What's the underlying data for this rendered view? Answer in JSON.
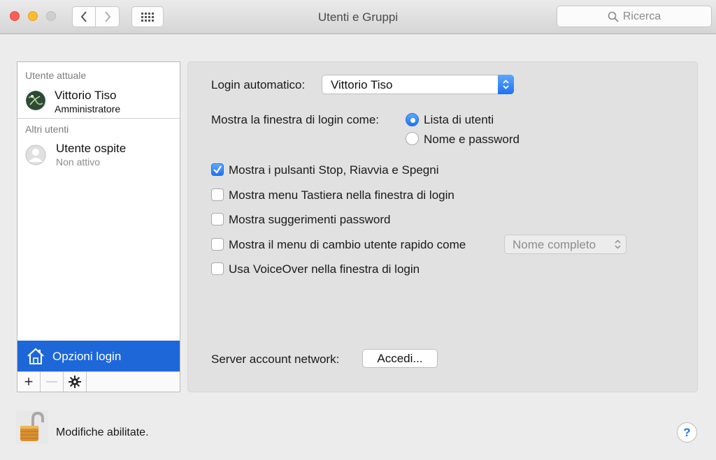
{
  "window": {
    "title": "Utenti e Gruppi"
  },
  "toolbar": {
    "search_placeholder": "Ricerca",
    "icons": {
      "back": "chevron-left-icon",
      "forward": "chevron-right-icon",
      "grid": "grid-icon",
      "search": "search-icon"
    }
  },
  "sidebar": {
    "current_user_header": "Utente attuale",
    "current_user": {
      "name": "Vittorio Tiso",
      "role": "Amministratore"
    },
    "other_users_header": "Altri utenti",
    "other_users": [
      {
        "name": "Utente ospite",
        "status": "Non attivo"
      }
    ],
    "login_options_label": "Opzioni login",
    "selected_color": "#1d67d9",
    "tools": {
      "add": "+",
      "remove": "—",
      "gear": "gear-icon"
    }
  },
  "main": {
    "auto_login_label": "Login automatico:",
    "auto_login_value": "Vittorio Tiso",
    "login_window_label": "Mostra la finestra di login come:",
    "radio_options": [
      {
        "label": "Lista di utenti",
        "selected": true
      },
      {
        "label": "Nome e password",
        "selected": false
      }
    ],
    "checkboxes": [
      {
        "label": "Mostra i pulsanti Stop, Riavvia e Spegni",
        "checked": true
      },
      {
        "label": "Mostra menu Tastiera nella finestra di login",
        "checked": false
      },
      {
        "label": "Mostra suggerimenti password",
        "checked": false
      },
      {
        "label": "Mostra il menu di cambio utente rapido come",
        "checked": false
      },
      {
        "label": "Usa VoiceOver nella finestra di login",
        "checked": false
      }
    ],
    "fast_switch_value": "Nome completo",
    "network_server_label": "Server account network:",
    "join_button": "Accedi..."
  },
  "footer": {
    "lock_text": "Modifiche abilitate.",
    "help_label": "?"
  }
}
